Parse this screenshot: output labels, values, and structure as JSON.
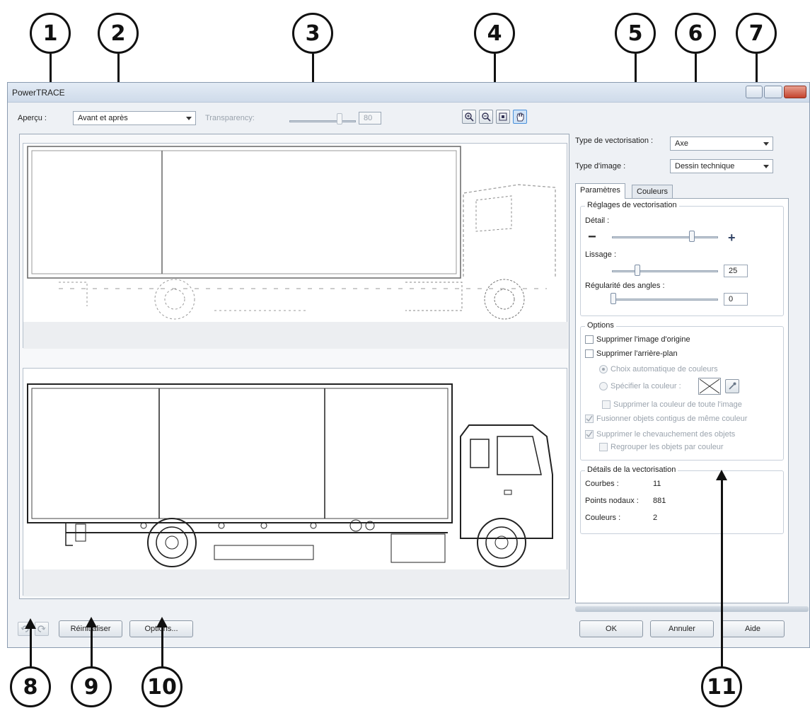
{
  "window": {
    "title": "PowerTRACE"
  },
  "toolbar": {
    "preview_label": "Aperçu :",
    "preview_value": "Avant et après",
    "transparency_label": "Transparency:",
    "transparency_value": "80"
  },
  "trace_type": {
    "label": "Type de vectorisation :",
    "value": "Axe"
  },
  "image_type": {
    "label": "Type d'image :",
    "value": "Dessin technique"
  },
  "tabs": [
    {
      "label": "Paramètres",
      "active": true
    },
    {
      "label": "Couleurs",
      "active": false
    }
  ],
  "trace_controls": {
    "group_title": "Réglages de vectorisation",
    "detail_label": "Détail :",
    "detail_minus": "−",
    "detail_plus": "+",
    "detail_level": 0.75,
    "smoothing_label": "Lissage :",
    "smoothing_value": "25",
    "corner_label": "Régularité des angles :",
    "corner_value": "0"
  },
  "options": {
    "group_title": "Options",
    "delete_original": "Supprimer l'image d'origine",
    "remove_background": "Supprimer l'arrière-plan",
    "auto_color": "Choix automatique de couleurs",
    "specify_color": "Spécifier la couleur :",
    "remove_color_entire": "Supprimer la couleur de toute l'image",
    "merge_adjacent": "Fusionner objets contigus de même couleur",
    "remove_overlap": "Supprimer le chevauchement des objets",
    "group_by_color": "Regrouper les objets par couleur"
  },
  "trace_result": {
    "group_title": "Détails de la vectorisation",
    "curves_label": "Courbes :",
    "curves_value": "11",
    "nodes_label": "Points nodaux :",
    "nodes_value": "881",
    "colors_label": "Couleurs :",
    "colors_value": "2"
  },
  "buttons": {
    "reset": "Réinitialiser",
    "options": "Options...",
    "ok": "OK",
    "cancel": "Annuler",
    "help": "Aide"
  },
  "callouts": [
    "1",
    "2",
    "3",
    "4",
    "5",
    "6",
    "7",
    "8",
    "9",
    "10",
    "11"
  ],
  "colors": {
    "accent": "#4a90d9",
    "window_bg": "#eef1f5",
    "close_button": "#c4442e"
  },
  "icons": [
    "zoom-in-icon",
    "zoom-out-icon",
    "fit-icon",
    "pan-hand-icon",
    "undo-icon",
    "redo-icon",
    "eyedropper-icon",
    "no-color-icon"
  ]
}
